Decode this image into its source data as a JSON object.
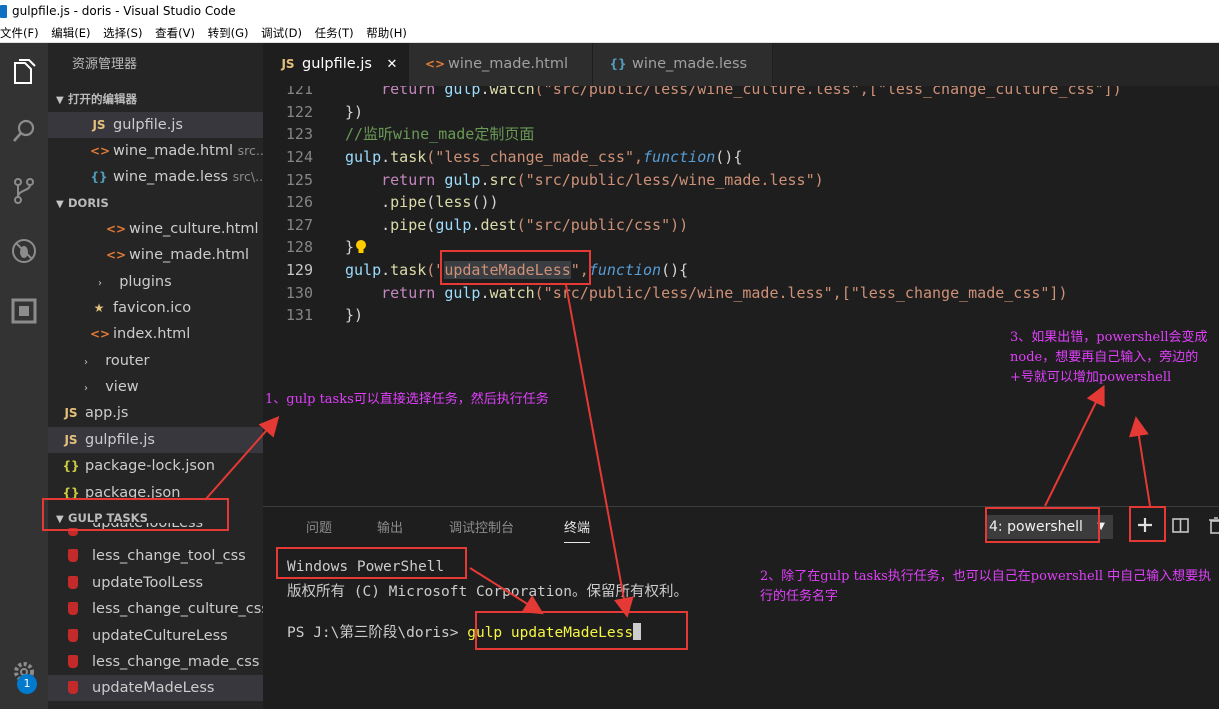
{
  "window_title": "gulpfile.js - doris - Visual Studio Code",
  "menu": [
    "文件(F)",
    "编辑(E)",
    "选择(S)",
    "查看(V)",
    "转到(G)",
    "调试(D)",
    "任务(T)",
    "帮助(H)"
  ],
  "sidebar": {
    "title": "资源管理器",
    "open_editors": {
      "label": "打开的编辑器",
      "items": [
        {
          "icon": "JS",
          "name": "gulpfile.js",
          "path": ""
        },
        {
          "icon": "<>",
          "name": "wine_made.html",
          "path": "src..."
        },
        {
          "icon": "{}",
          "name": "wine_made.less",
          "path": "src\\..."
        }
      ]
    },
    "project": {
      "label": "DORIS",
      "items": [
        {
          "icon": "<>",
          "name": "wine_culture.html"
        },
        {
          "icon": "<>",
          "name": "wine_made.html"
        },
        {
          "icon": "›",
          "name": "plugins"
        },
        {
          "icon": "★",
          "name": "favicon.ico"
        },
        {
          "icon": "<>",
          "name": "index.html"
        },
        {
          "icon": "›",
          "name": "router"
        },
        {
          "icon": "›",
          "name": "view"
        },
        {
          "icon": "JS",
          "name": "app.js"
        },
        {
          "icon": "JS",
          "name": "gulpfile.js"
        },
        {
          "icon": "{}",
          "name": "package-lock.json"
        },
        {
          "icon": "{}",
          "name": "package.json"
        }
      ]
    },
    "gulp_tasks": {
      "label": "GULP TASKS",
      "items": [
        "updateToolLess",
        "less_change_tool_css",
        "updateToolLess",
        "less_change_culture_css",
        "updateCultureLess",
        "less_change_made_css",
        "updateMadeLess"
      ]
    },
    "badge_count": "1"
  },
  "tabs": [
    {
      "icon": "JS",
      "label": "gulpfile.js",
      "close": "✕",
      "active": true
    },
    {
      "icon": "<>",
      "label": "wine_made.html",
      "active": false
    },
    {
      "icon": "{}",
      "label": "wine_made.less",
      "active": false
    }
  ],
  "editor": {
    "line_numbers": [
      "121",
      "122",
      "123",
      "124",
      "125",
      "126",
      "127",
      "128",
      "129",
      "130",
      "131"
    ],
    "lines": {
      "l121": {
        "indent": "    ",
        "kw": "return",
        "obj": "gulp",
        "dot": ".",
        "fn": "watch",
        "rest": "(\"src/public/less/wine_culture.less\",[\"less_change_culture_css\"])"
      },
      "l122": "})",
      "l123": "//监听wine_made定制页面",
      "l124": {
        "obj": "gulp",
        "dot": ".",
        "fn": "task",
        "str": "(\"less_change_made_css\",",
        "kw": "function",
        "rest": "(){"
      },
      "l125": {
        "indent": "    ",
        "kw": "return",
        "obj": "gulp",
        "dot": ".",
        "fn": "src",
        "str": "(\"src/public/less/wine_made.less\")"
      },
      "l126": {
        "indent": "    ",
        "dot": ".",
        "fn": "pipe",
        "p1": "(",
        "fn2": "less",
        "rest": "())"
      },
      "l127": {
        "indent": "    ",
        "dot": ".",
        "fn": "pipe",
        "p1": "(",
        "obj": "gulp",
        "dot2": ".",
        "fn2": "dest",
        "str": "(\"src/public/css\"))"
      },
      "l128": "}",
      "l129": {
        "obj": "gulp",
        "dot": ".",
        "fn": "task",
        "p1": "(\"",
        "str": "updateMadeLess",
        "p2": "\",",
        "kw": "function",
        "rest": "(){"
      },
      "l130": {
        "indent": "    ",
        "kw": "return",
        "obj": "gulp",
        "dot": ".",
        "fn": "watch",
        "rest": "(\"src/public/less/wine_made.less\",[\"less_change_made_css\"])"
      },
      "l131": "})"
    }
  },
  "panel": {
    "tabs": [
      "问题",
      "输出",
      "调试控制台",
      "终端"
    ],
    "active_tab": "终端",
    "terminal_select": "4: powershell",
    "terminal_lines": [
      "Windows PowerShell",
      "版权所有 (C) Microsoft Corporation。保留所有权利。"
    ],
    "prompt": "PS J:\\第三阶段\\doris>",
    "command": "gulp updateMadeLess"
  },
  "annotations": {
    "note1": "1、gulp tasks可以直接选择任务，然后执行任务",
    "note2": "2、除了在gulp tasks执行任务，也可以自己在powershell 中自己输入想要执行的任务名字",
    "note3": "3、如果出错，powershell会变成node，想要再自己输入，旁边的+号就可以增加powershell"
  },
  "colors": {
    "annotation_box": "#e53935",
    "annotation_text": "#e040fb",
    "accent": "#007acc"
  }
}
